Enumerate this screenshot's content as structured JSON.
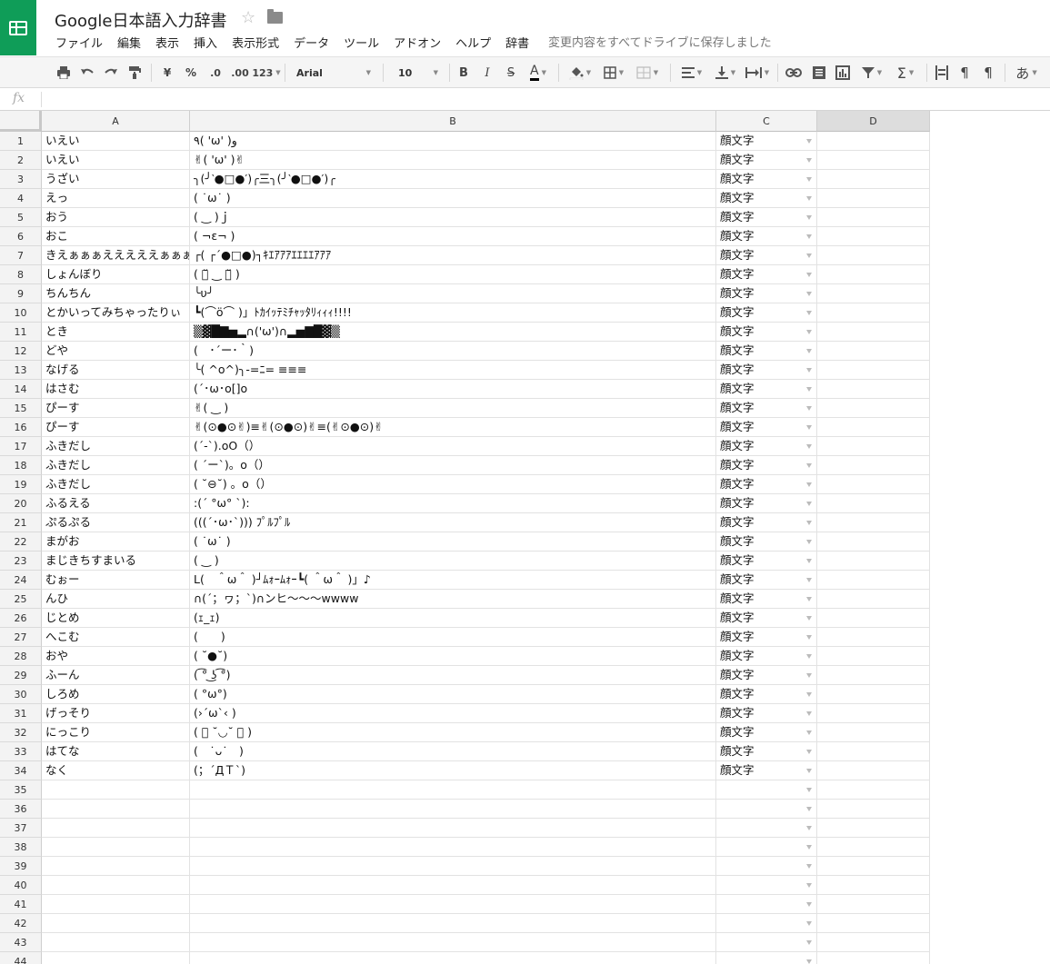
{
  "doc": {
    "title": "Google日本語入力辞書"
  },
  "menu": [
    "ファイル",
    "編集",
    "表示",
    "挿入",
    "表示形式",
    "データ",
    "ツール",
    "アドオン",
    "ヘルプ",
    "辞書"
  ],
  "save_status": "変更内容をすべてドライブに保存しました",
  "toolbar": {
    "currency": "¥",
    "percent": "%",
    "decimal_decrease": ".0",
    "decimal_increase": ".00",
    "number_format": "123",
    "font": "Arial",
    "font_size": "10",
    "bold": "B",
    "italic": "I",
    "strikethrough": "S",
    "text_color": "A",
    "input_tool": "あ"
  },
  "formula": {
    "fx": "fx",
    "value": ""
  },
  "columns": [
    "A",
    "B",
    "C",
    "D"
  ],
  "rows": [
    {
      "num": "1",
      "a": "いえい",
      "b": "٩( 'ω' )و",
      "c": "顔文字"
    },
    {
      "num": "2",
      "a": "いえい",
      "b": "✌( 'ω' )✌",
      "c": "顔文字"
    },
    {
      "num": "3",
      "a": "うざい",
      "b": "╮(╯‵●□●′)╭三╮(╯‵●□●′)╭",
      "c": "顔文字"
    },
    {
      "num": "4",
      "a": "えっ",
      "b": "( ˙ω˙ )",
      "c": "顔文字"
    },
    {
      "num": "5",
      "a": "おう",
      "b": "( ‿ )ｊ",
      "c": "顔文字"
    },
    {
      "num": "6",
      "a": "おこ",
      "b": "( ¬ε¬ )",
      "c": "顔文字"
    },
    {
      "num": "7",
      "a": "きえぁぁぁえええええぁぁぁ",
      "b": "┌( ┌´●□●)┐ｷｴｱｱｱｴｴｴｴｱｱｱ",
      "c": "顔文字"
    },
    {
      "num": "8",
      "a": "しょんぼり",
      "b": "( ･̆ ‿ ･̆ )",
      "c": "顔文字"
    },
    {
      "num": "9",
      "a": "ちんちん",
      "b": "╰υ╯",
      "c": "顔文字"
    },
    {
      "num": "10",
      "a": "とかいってみちゃったりぃ",
      "b": "┗(⌒ö⌒ )」ﾄｶｲｯﾃﾐﾁｬｯﾀﾘｨｨｨ!!!!",
      "c": "顔文字"
    },
    {
      "num": "11",
      "a": "とき",
      "b": "▒▓█▇▅▂∩('ω')∩▂▅▇█▓▒",
      "c": "顔文字"
    },
    {
      "num": "12",
      "a": "どや",
      "b": "(　･´ー･｀)",
      "c": "顔文字"
    },
    {
      "num": "13",
      "a": "なげる",
      "b": "╰( ^o^)╮-=ﾆ= ≡≡≡",
      "c": "顔文字"
    },
    {
      "num": "14",
      "a": "はさむ",
      "b": "(´･ω･o[]o",
      "c": "顔文字"
    },
    {
      "num": "15",
      "a": "ぴーす",
      "b": "✌( ‿ )",
      "c": "顔文字"
    },
    {
      "num": "16",
      "a": "ぴーす",
      "b": "✌(⊙●⊙✌)≡✌(⊙●⊙)✌≡(✌⊙●⊙)✌",
      "c": "顔文字"
    },
    {
      "num": "17",
      "a": "ふきだし",
      "b": "(´-`).oO（）",
      "c": "顔文字"
    },
    {
      "num": "18",
      "a": "ふきだし",
      "b": "( ´ー`)。o（）",
      "c": "顔文字"
    },
    {
      "num": "19",
      "a": "ふきだし",
      "b": "( ˘⊖˘) 。o（）",
      "c": "顔文字"
    },
    {
      "num": "20",
      "a": "ふるえる",
      "b": ":(´ °ω° `):",
      "c": "顔文字"
    },
    {
      "num": "21",
      "a": "ぷるぷる",
      "b": "(((´･ω･`))) ﾌﾟﾙﾌﾟﾙ",
      "c": "顔文字"
    },
    {
      "num": "22",
      "a": "まがお",
      "b": "( ˙ω˙ )",
      "c": "顔文字"
    },
    {
      "num": "23",
      "a": "まじきちすまいる",
      "b": "( ‿ )",
      "c": "顔文字"
    },
    {
      "num": "24",
      "a": "むぉー",
      "b": "L(　＾ω＾ )┘ﾑｫｰﾑｫｰ┗( ＾ω＾ )」♪",
      "c": "顔文字"
    },
    {
      "num": "25",
      "a": "んひ",
      "b": "∩(´；ヮ；`)∩ンヒ〜〜〜wwww",
      "c": "顔文字"
    },
    {
      "num": "26",
      "a": "じとめ",
      "b": "(ｪ_ｪ)",
      "c": "顔文字"
    },
    {
      "num": "27",
      "a": "へこむ",
      "b": "(　　)",
      "c": "顔文字"
    },
    {
      "num": "28",
      "a": "おや",
      "b": "( ˘●˘)",
      "c": "顔文字"
    },
    {
      "num": "29",
      "a": "ふーん",
      "b": "( ͡° ͜ʖ ͡°)",
      "c": "顔文字"
    },
    {
      "num": "30",
      "a": "しろめ",
      "b": "( °ω°)",
      "c": "顔文字"
    },
    {
      "num": "31",
      "a": "げっそり",
      "b": "(›´ω`‹ )",
      "c": "顔文字"
    },
    {
      "num": "32",
      "a": "にっこり",
      "b": "( ﾞ ˘◡˘ ﾞ )",
      "c": "顔文字"
    },
    {
      "num": "33",
      "a": "はてな",
      "b": "(　˙ᴗ˙　)",
      "c": "顔文字"
    },
    {
      "num": "34",
      "a": "なく",
      "b": "(；´ДＴ`)",
      "c": "顔文字"
    },
    {
      "num": "35",
      "a": "",
      "b": "",
      "c": ""
    },
    {
      "num": "36",
      "a": "",
      "b": "",
      "c": ""
    },
    {
      "num": "37",
      "a": "",
      "b": "",
      "c": ""
    },
    {
      "num": "38",
      "a": "",
      "b": "",
      "c": ""
    },
    {
      "num": "39",
      "a": "",
      "b": "",
      "c": ""
    },
    {
      "num": "40",
      "a": "",
      "b": "",
      "c": ""
    },
    {
      "num": "41",
      "a": "",
      "b": "",
      "c": ""
    },
    {
      "num": "42",
      "a": "",
      "b": "",
      "c": ""
    },
    {
      "num": "43",
      "a": "",
      "b": "",
      "c": ""
    },
    {
      "num": "44",
      "a": "",
      "b": "",
      "c": ""
    }
  ]
}
